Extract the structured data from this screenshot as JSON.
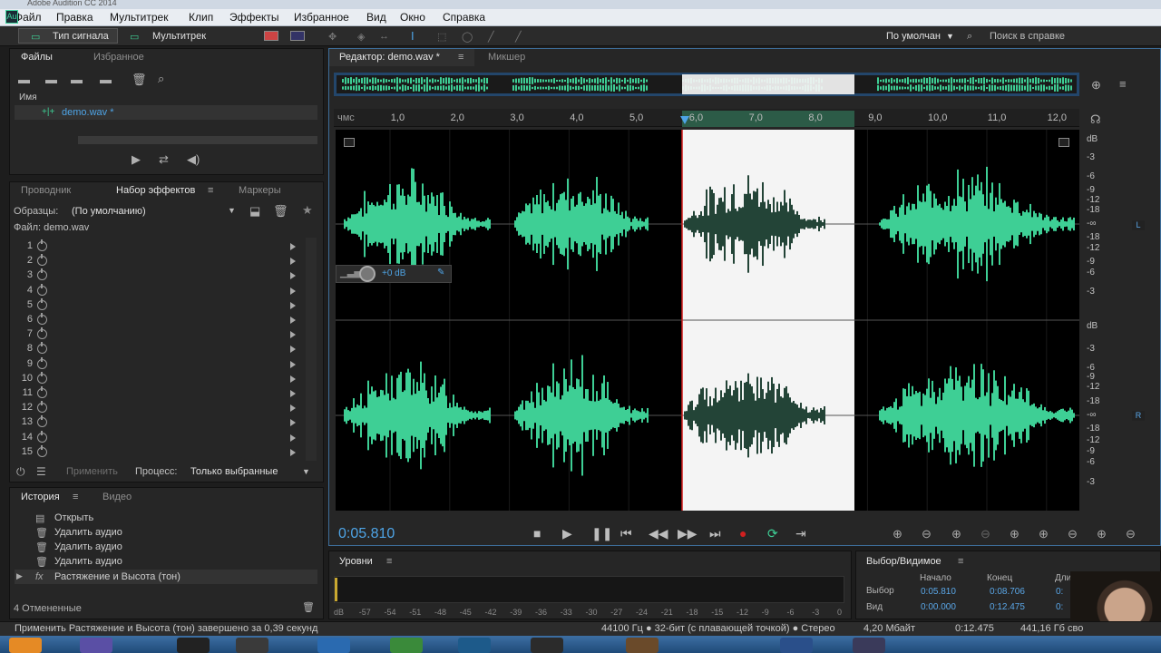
{
  "window": {
    "title": "Adobe Audition CC 2014"
  },
  "menu": [
    "Файл",
    "Правка",
    "Мультитрек",
    "Клип",
    "Эффекты",
    "Избранное",
    "Вид",
    "Окно",
    "Справка"
  ],
  "toolbar": {
    "waveform_label": "Тип сигнала",
    "multitrack_label": "Мультитрек",
    "workspace": "По умолчан",
    "help_search": "Поиск в справке"
  },
  "files_panel": {
    "tabs": [
      "Файлы",
      "Избранное"
    ],
    "column_name": "Имя",
    "files": [
      "demo.wav *"
    ]
  },
  "effects_panel": {
    "tabs": [
      "Проводник",
      "Набор эффектов",
      "Маркеры"
    ],
    "presets_label": "Образцы:",
    "presets_value": "(По умолчанию)",
    "file_label": "Файл: demo.wav",
    "slots": [
      "1",
      "2",
      "3",
      "4",
      "5",
      "6",
      "7",
      "8",
      "9",
      "10",
      "11",
      "12",
      "13",
      "14",
      "15"
    ],
    "apply_label": "Применить",
    "process_label": "Процесс:",
    "process_value": "Только выбранные"
  },
  "history_panel": {
    "tabs": [
      "История",
      "Видео"
    ],
    "items": [
      "Открыть",
      "Удалить аудио",
      "Удалить аудио",
      "Удалить аудио",
      "Растяжение и Высота (тон)"
    ],
    "undo_count": "4 Отмененные"
  },
  "editor": {
    "tabs": [
      "Редактор: demo.wav *",
      "Микшер"
    ],
    "ruler_unit": "чмс",
    "ruler_ticks": [
      "1,0",
      "2,0",
      "3,0",
      "4,0",
      "5,0",
      "6,0",
      "7,0",
      "8,0",
      "9,0",
      "10,0",
      "11,0",
      "12,0"
    ],
    "hud_gain": "+0 dB",
    "channel_left": "L",
    "channel_right": "R",
    "db_scale": [
      "dB",
      "-3",
      "-6",
      "-9",
      "-12",
      "-18",
      "-∞",
      "-18",
      "-12",
      "-9",
      "-6",
      "-3"
    ],
    "current_time": "0:05.810",
    "selection_start_sec": 5.81,
    "selection_end_sec": 8.706,
    "duration_sec": 12.475
  },
  "levels_panel": {
    "title": "Уровни",
    "scale": [
      "dB",
      "-57",
      "-54",
      "-51",
      "-48",
      "-45",
      "-42",
      "-39",
      "-36",
      "-33",
      "-30",
      "-27",
      "-24",
      "-21",
      "-18",
      "-15",
      "-12",
      "-9",
      "-6",
      "-3",
      "0"
    ]
  },
  "selection_panel": {
    "title": "Выбор/Видимое",
    "headers": [
      "Начало",
      "Конец",
      "Длительность"
    ],
    "rows": [
      {
        "label": "Выбор",
        "start": "0:05.810",
        "end": "0:08.706",
        "duration": "0:"
      },
      {
        "label": "Вид",
        "start": "0:00.000",
        "end": "0:12.475",
        "duration": "0:"
      }
    ]
  },
  "status_bar": {
    "message": "Применить Растяжение и Высота (тон) завершено за 0,39 секунд",
    "format": "44100 Гц ● 32-бит (с плавающей точкой) ● Стерео",
    "size": "4,20 Мбайт",
    "duration": "0:12.475",
    "free_space": "441,16 Гб сво"
  },
  "colors": {
    "waveform": "#3ecf95",
    "waveform_selected": "#234437",
    "selection_bg": "#f4f4f4",
    "accent_blue": "#4ea4e6",
    "playhead": "#d01a1a"
  }
}
